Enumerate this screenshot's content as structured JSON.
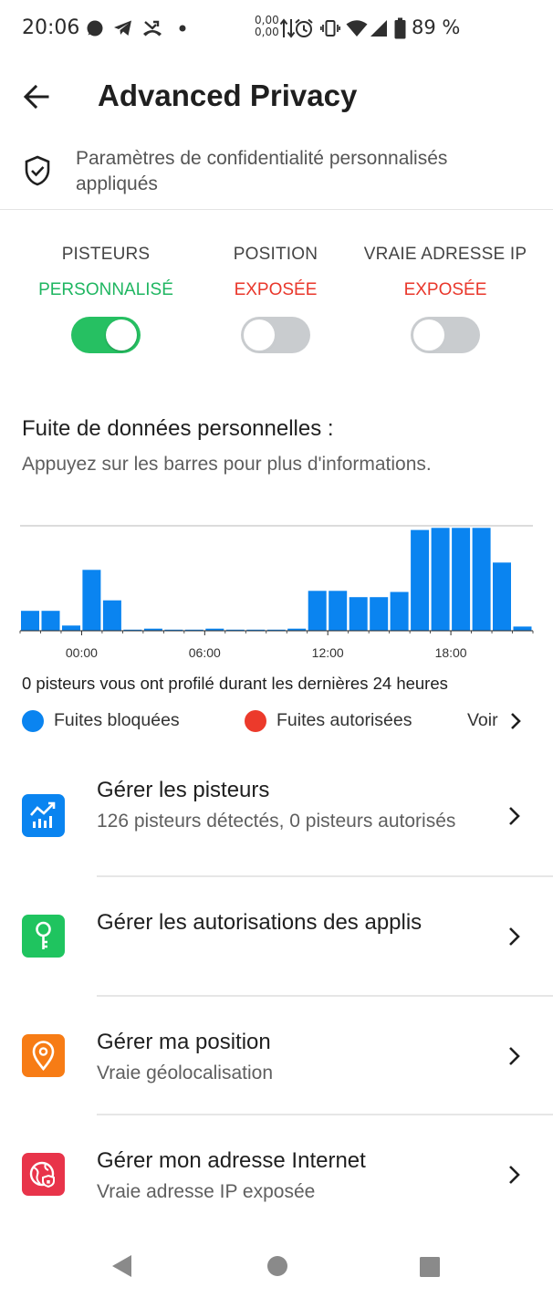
{
  "status_bar": {
    "time": "20:06",
    "net_speed_up": "0,00",
    "net_speed_down": "0,00",
    "battery": "89 %",
    "left_icons": [
      "signal-chat-icon",
      "telegram-icon",
      "call-missed-icon",
      "dot-icon"
    ],
    "right_icons": [
      "data-transfer-icon",
      "alarm-icon",
      "vibrate-icon",
      "wifi-icon",
      "cell-signal-icon",
      "battery-icon"
    ]
  },
  "app_bar": {
    "title": "Advanced Privacy"
  },
  "banner": {
    "text": "Paramètres de confidentialité personnalisés appliqués",
    "icon": "shield-check-icon"
  },
  "toggles": [
    {
      "label": "PISTEURS",
      "state": "PERSONNALISÉ",
      "state_color": "#1fb661",
      "on": true
    },
    {
      "label": "POSITION",
      "state": "EXPOSÉE",
      "state_color": "#e9372b",
      "on": false
    },
    {
      "label": "VRAIE ADRESSE IP",
      "state": "EXPOSÉE",
      "state_color": "#e9372b",
      "on": false
    }
  ],
  "leak": {
    "title": "Fuite de données personnelles :",
    "subtitle": "Appuyez sur les barres pour plus d'informations."
  },
  "chart_data": {
    "type": "bar",
    "ticks": [
      "00:00",
      "06:00",
      "12:00",
      "18:00"
    ],
    "series": [
      {
        "name": "Fuites bloquées",
        "color": "#0a84f0",
        "values": [
          0.19,
          0.19,
          0.05,
          0.58,
          0.29,
          0.01,
          0.02,
          0.01,
          0.01,
          0.02,
          0.01,
          0.01,
          0.01,
          0.02,
          0.38,
          0.38,
          0.32,
          0.32,
          0.37,
          0.96,
          0.98,
          0.98,
          0.98,
          0.65,
          0.04
        ]
      },
      {
        "name": "Fuites autorisées",
        "color": "#ec3a2b",
        "values": [
          0,
          0,
          0,
          0,
          0,
          0,
          0,
          0,
          0,
          0,
          0,
          0,
          0,
          0,
          0,
          0,
          0,
          0,
          0,
          0,
          0,
          0,
          0,
          0,
          0
        ]
      }
    ],
    "grid": "top line only"
  },
  "profiled_text": "0 pisteurs vous ont profilé durant les dernières 24 heures",
  "legend": {
    "blocked": {
      "label": "Fuites bloquées",
      "color": "#0a84f0"
    },
    "allowed": {
      "label": "Fuites autorisées",
      "color": "#ec3a2b"
    },
    "see_more": "Voir"
  },
  "menu": [
    {
      "title": "Gérer les pisteurs",
      "subtitle": "126 pisteurs détectés, 0 pisteurs autorisés",
      "icon": "trackers-chart-icon",
      "color": "#0a84f0"
    },
    {
      "title": "Gérer les autorisations des applis",
      "subtitle": "",
      "icon": "key-icon",
      "color": "#1fc45f"
    },
    {
      "title": "Gérer ma position",
      "subtitle": "Vraie géolocalisation",
      "icon": "location-pin-icon",
      "color": "#f77c15"
    },
    {
      "title": "Gérer mon adresse Internet",
      "subtitle": "Vraie adresse IP exposée",
      "icon": "globe-shield-icon",
      "color": "#e8344a"
    }
  ],
  "nav_bar": {
    "icons": [
      "nav-back-icon",
      "nav-home-icon",
      "nav-recents-icon"
    ]
  }
}
